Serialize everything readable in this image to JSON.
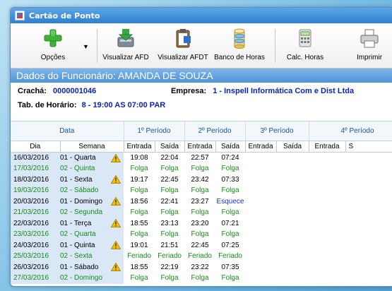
{
  "window": {
    "title": "Cartão de Ponto"
  },
  "toolbar": {
    "buttons": [
      {
        "label": "Opções",
        "icon": "plus-icon"
      },
      {
        "label": "Visualizar AFD",
        "icon": "download-disk-icon"
      },
      {
        "label": "Visualizar AFDT",
        "icon": "clipboard-icon"
      },
      {
        "label": "Banco de Horas",
        "icon": "database-icon"
      },
      {
        "label": "Calc. Horas",
        "icon": "calculator-icon"
      },
      {
        "label": "Imprimir",
        "icon": "printer-icon"
      }
    ]
  },
  "employee": {
    "header": "Dados do Funcionário: AMANDA DE SOUZA",
    "cracha_label": "Crachá:",
    "cracha_value": "0000001046",
    "empresa_label": "Empresa:",
    "empresa_value": "1 - Inspell Informática Com e Dist Ltda",
    "horario_label": "Tab. de Horário:",
    "horario_value": "8 - 19:00 AS 07:00 PAR"
  },
  "grid": {
    "group_headers": [
      "Data",
      "1º Período",
      "2º Período",
      "3º Período",
      "4º Período"
    ],
    "column_headers": [
      "Dia",
      "Semana",
      "Entrada",
      "Saída",
      "Entrada",
      "Saída",
      "Entrada",
      "Saída",
      "Entrada",
      "S"
    ],
    "rows": [
      {
        "date": "16/03/2016",
        "week": "01 - Quarta",
        "warn": true,
        "p": [
          "19:08",
          "22:04",
          "22:57",
          "07:24"
        ],
        "kind": "work"
      },
      {
        "date": "17/03/2016",
        "week": "02 - Quinta",
        "warn": false,
        "p": [
          "Folga",
          "Folga",
          "Folga",
          "Folga"
        ],
        "kind": "folga"
      },
      {
        "date": "18/03/2016",
        "week": "01 - Sexta",
        "warn": true,
        "p": [
          "19:17",
          "22:45",
          "23:42",
          "07:33"
        ],
        "kind": "work"
      },
      {
        "date": "19/03/2016",
        "week": "02 - Sábado",
        "warn": false,
        "p": [
          "Folga",
          "Folga",
          "Folga",
          "Folga"
        ],
        "kind": "folga"
      },
      {
        "date": "20/03/2016",
        "week": "01 - Domingo",
        "warn": true,
        "p": [
          "18:56",
          "22:41",
          "23:27",
          "Esquece"
        ],
        "kind": "work"
      },
      {
        "date": "21/03/2016",
        "week": "02 - Segunda",
        "warn": false,
        "p": [
          "Folga",
          "Folga",
          "Folga",
          "Folga"
        ],
        "kind": "folga"
      },
      {
        "date": "22/03/2016",
        "week": "01 - Terça",
        "warn": true,
        "p": [
          "18:55",
          "23:13",
          "23:20",
          "07:21"
        ],
        "kind": "work"
      },
      {
        "date": "23/03/2016",
        "week": "02 - Quarta",
        "warn": false,
        "p": [
          "Folga",
          "Folga",
          "Folga",
          "Folga"
        ],
        "kind": "folga"
      },
      {
        "date": "24/03/2016",
        "week": "01 - Quinta",
        "warn": true,
        "p": [
          "19:01",
          "21:51",
          "22:45",
          "07:25"
        ],
        "kind": "work"
      },
      {
        "date": "25/03/2016",
        "week": "02 - Sexta",
        "warn": false,
        "p": [
          "Feriado",
          "Feriado",
          "Feriado",
          "Feriado"
        ],
        "kind": "folga"
      },
      {
        "date": "26/03/2016",
        "week": "01 - Sábado",
        "warn": true,
        "p": [
          "18:55",
          "22:19",
          "23:22",
          "07:35"
        ],
        "kind": "work"
      },
      {
        "date": "27/03/2016",
        "week": "02 - Domingo",
        "warn": false,
        "p": [
          "Folga",
          "Folga",
          "Folga",
          "Folga"
        ],
        "kind": "folga"
      }
    ]
  },
  "colors": {
    "accent": "#4f93d8",
    "value_blue": "#0b22b8",
    "folga_green": "#168d16",
    "warning_yellow": "#f2c200"
  }
}
